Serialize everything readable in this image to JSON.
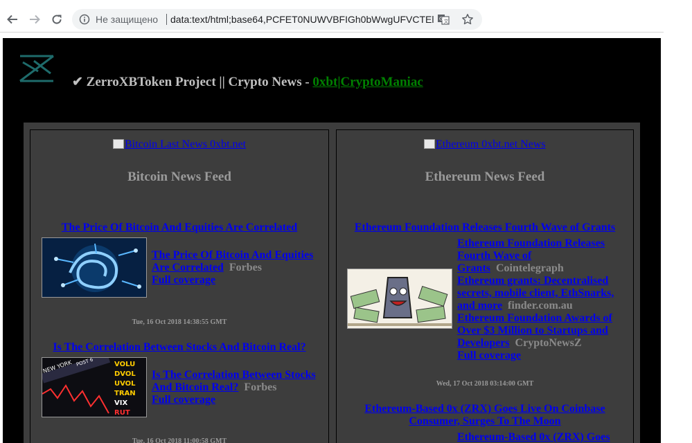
{
  "browser": {
    "security_status": "Не защищено",
    "url": "data:text/html;base64,PCFET0NUWVBFIGh0bWwgUFVCTEl...",
    "icons": [
      "back-arrow-icon",
      "forward-arrow-icon",
      "reload-icon",
      "info-icon",
      "translate-icon",
      "star-icon"
    ]
  },
  "header": {
    "title_prefix": "✔ ZerroXBToken Project || Crypto News - ",
    "title_link": "0xbt|CryptoManiac",
    "link_color": "#008000"
  },
  "bitcoin": {
    "banner_alt": "Bitcoin Last News 0xbt.net",
    "heading": "Bitcoin News Feed",
    "items": [
      {
        "headline": "The Price Of Bitcoin And Equities Are Correlated",
        "link_line1": "The Price Of Bitcoin And Equities",
        "link_line2": "Are Correlated",
        "source": "Forbes",
        "coverage": "Full coverage",
        "date": "Tue, 16 Oct 2018 14:38:55 GMT"
      },
      {
        "headline": "Is The Correlation Between Stocks And Bitcoin Real?",
        "link_line1": "Is The Correlation Between Stocks",
        "link_line2": "And Bitcoin Real?",
        "source": "Forbes",
        "coverage": "Full coverage",
        "date": "Tue, 16 Oct 2018 11:00:58 GMT",
        "stock_words": [
          "VOLU",
          "DVOL",
          "UVOL",
          "TRAN",
          "VIX",
          "RUT",
          "NEW YORK",
          "POST 6"
        ]
      }
    ]
  },
  "ethereum": {
    "banner_alt": "Ethereum 0xbt.net News",
    "heading": "Ethereum News Feed",
    "items": [
      {
        "headline": "Ethereum Foundation Releases Fourth Wave of Grants",
        "links": [
          {
            "lines": [
              "Ethereum Foundation Releases",
              "Fourth Wave of",
              "Grants"
            ],
            "source": "Cointelegraph"
          },
          {
            "lines": [
              "Ethereum grants: Decentralised",
              "secrets, mobile client, EthSnarks,",
              "and more"
            ],
            "source": "finder.com.au"
          },
          {
            "lines": [
              "Ethereum Foundation Awards of",
              "Over $3 Million to Startups and",
              "Developers"
            ],
            "source": "CryptoNewsZ"
          }
        ],
        "coverage": "Full coverage",
        "date": "Wed, 17 Oct 2018 03:14:00 GMT"
      },
      {
        "headline_line1": "Ethereum-Based 0x (ZRX) Goes Live On Coinbase",
        "headline_line2": "Consumer, Surges To The Moon",
        "link_line1": "Ethereum-Based 0x (ZRX) Goes"
      }
    ]
  }
}
